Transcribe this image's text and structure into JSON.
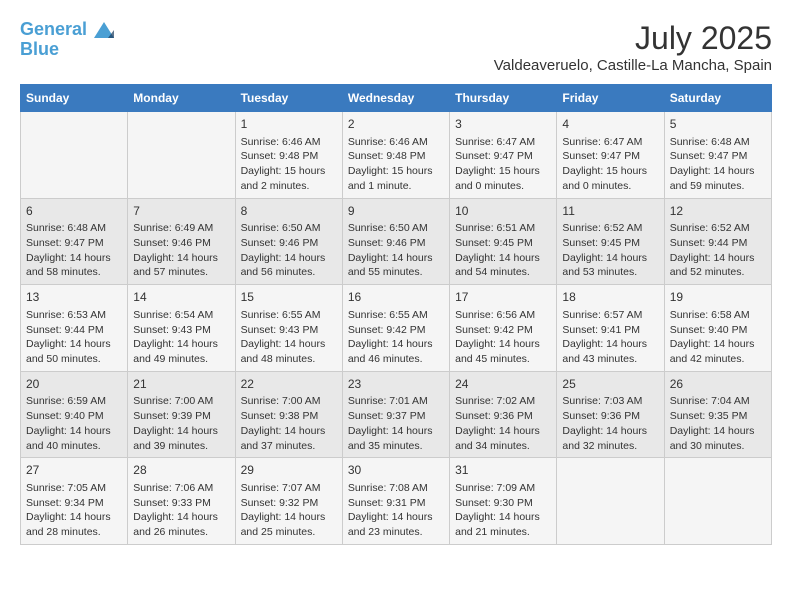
{
  "logo": {
    "line1": "General",
    "line2": "Blue"
  },
  "title": "July 2025",
  "subtitle": "Valdeaveruelo, Castille-La Mancha, Spain",
  "headers": [
    "Sunday",
    "Monday",
    "Tuesday",
    "Wednesday",
    "Thursday",
    "Friday",
    "Saturday"
  ],
  "weeks": [
    [
      {
        "num": "",
        "info": ""
      },
      {
        "num": "",
        "info": ""
      },
      {
        "num": "1",
        "info": "Sunrise: 6:46 AM\nSunset: 9:48 PM\nDaylight: 15 hours and 2 minutes."
      },
      {
        "num": "2",
        "info": "Sunrise: 6:46 AM\nSunset: 9:48 PM\nDaylight: 15 hours and 1 minute."
      },
      {
        "num": "3",
        "info": "Sunrise: 6:47 AM\nSunset: 9:47 PM\nDaylight: 15 hours and 0 minutes."
      },
      {
        "num": "4",
        "info": "Sunrise: 6:47 AM\nSunset: 9:47 PM\nDaylight: 15 hours and 0 minutes."
      },
      {
        "num": "5",
        "info": "Sunrise: 6:48 AM\nSunset: 9:47 PM\nDaylight: 14 hours and 59 minutes."
      }
    ],
    [
      {
        "num": "6",
        "info": "Sunrise: 6:48 AM\nSunset: 9:47 PM\nDaylight: 14 hours and 58 minutes."
      },
      {
        "num": "7",
        "info": "Sunrise: 6:49 AM\nSunset: 9:46 PM\nDaylight: 14 hours and 57 minutes."
      },
      {
        "num": "8",
        "info": "Sunrise: 6:50 AM\nSunset: 9:46 PM\nDaylight: 14 hours and 56 minutes."
      },
      {
        "num": "9",
        "info": "Sunrise: 6:50 AM\nSunset: 9:46 PM\nDaylight: 14 hours and 55 minutes."
      },
      {
        "num": "10",
        "info": "Sunrise: 6:51 AM\nSunset: 9:45 PM\nDaylight: 14 hours and 54 minutes."
      },
      {
        "num": "11",
        "info": "Sunrise: 6:52 AM\nSunset: 9:45 PM\nDaylight: 14 hours and 53 minutes."
      },
      {
        "num": "12",
        "info": "Sunrise: 6:52 AM\nSunset: 9:44 PM\nDaylight: 14 hours and 52 minutes."
      }
    ],
    [
      {
        "num": "13",
        "info": "Sunrise: 6:53 AM\nSunset: 9:44 PM\nDaylight: 14 hours and 50 minutes."
      },
      {
        "num": "14",
        "info": "Sunrise: 6:54 AM\nSunset: 9:43 PM\nDaylight: 14 hours and 49 minutes."
      },
      {
        "num": "15",
        "info": "Sunrise: 6:55 AM\nSunset: 9:43 PM\nDaylight: 14 hours and 48 minutes."
      },
      {
        "num": "16",
        "info": "Sunrise: 6:55 AM\nSunset: 9:42 PM\nDaylight: 14 hours and 46 minutes."
      },
      {
        "num": "17",
        "info": "Sunrise: 6:56 AM\nSunset: 9:42 PM\nDaylight: 14 hours and 45 minutes."
      },
      {
        "num": "18",
        "info": "Sunrise: 6:57 AM\nSunset: 9:41 PM\nDaylight: 14 hours and 43 minutes."
      },
      {
        "num": "19",
        "info": "Sunrise: 6:58 AM\nSunset: 9:40 PM\nDaylight: 14 hours and 42 minutes."
      }
    ],
    [
      {
        "num": "20",
        "info": "Sunrise: 6:59 AM\nSunset: 9:40 PM\nDaylight: 14 hours and 40 minutes."
      },
      {
        "num": "21",
        "info": "Sunrise: 7:00 AM\nSunset: 9:39 PM\nDaylight: 14 hours and 39 minutes."
      },
      {
        "num": "22",
        "info": "Sunrise: 7:00 AM\nSunset: 9:38 PM\nDaylight: 14 hours and 37 minutes."
      },
      {
        "num": "23",
        "info": "Sunrise: 7:01 AM\nSunset: 9:37 PM\nDaylight: 14 hours and 35 minutes."
      },
      {
        "num": "24",
        "info": "Sunrise: 7:02 AM\nSunset: 9:36 PM\nDaylight: 14 hours and 34 minutes."
      },
      {
        "num": "25",
        "info": "Sunrise: 7:03 AM\nSunset: 9:36 PM\nDaylight: 14 hours and 32 minutes."
      },
      {
        "num": "26",
        "info": "Sunrise: 7:04 AM\nSunset: 9:35 PM\nDaylight: 14 hours and 30 minutes."
      }
    ],
    [
      {
        "num": "27",
        "info": "Sunrise: 7:05 AM\nSunset: 9:34 PM\nDaylight: 14 hours and 28 minutes."
      },
      {
        "num": "28",
        "info": "Sunrise: 7:06 AM\nSunset: 9:33 PM\nDaylight: 14 hours and 26 minutes."
      },
      {
        "num": "29",
        "info": "Sunrise: 7:07 AM\nSunset: 9:32 PM\nDaylight: 14 hours and 25 minutes."
      },
      {
        "num": "30",
        "info": "Sunrise: 7:08 AM\nSunset: 9:31 PM\nDaylight: 14 hours and 23 minutes."
      },
      {
        "num": "31",
        "info": "Sunrise: 7:09 AM\nSunset: 9:30 PM\nDaylight: 14 hours and 21 minutes."
      },
      {
        "num": "",
        "info": ""
      },
      {
        "num": "",
        "info": ""
      }
    ]
  ]
}
